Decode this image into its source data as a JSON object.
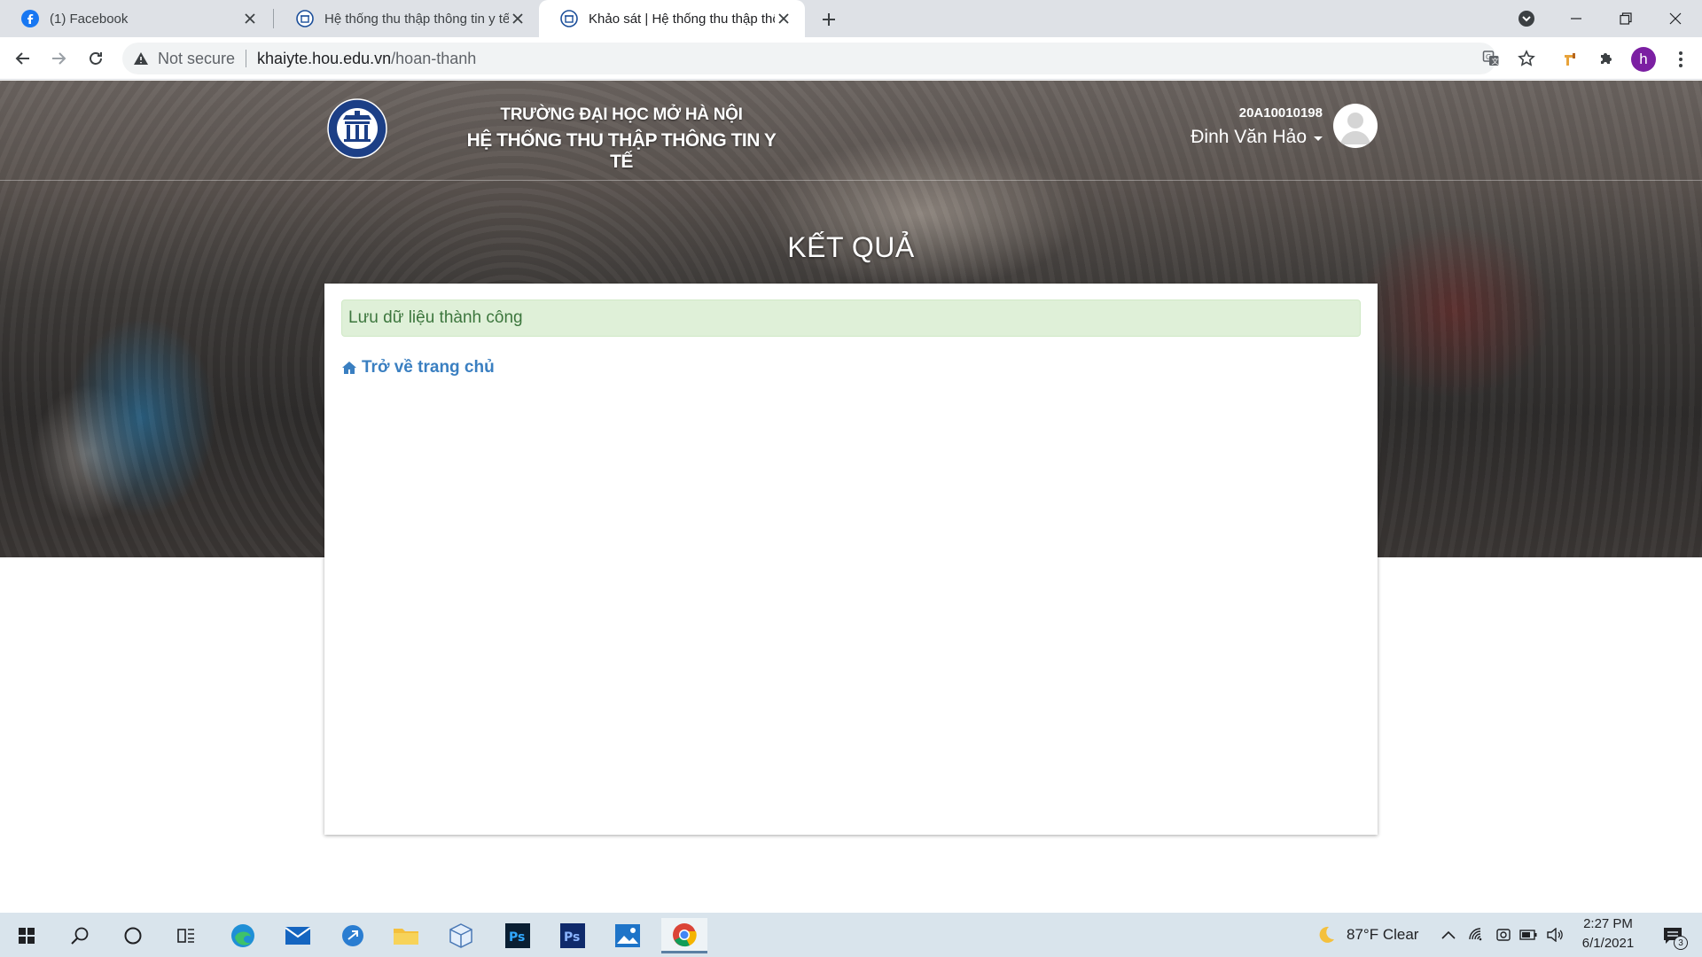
{
  "browser": {
    "tabs": [
      {
        "title": "(1) Facebook",
        "icon": "facebook-icon"
      },
      {
        "title": "Hệ thống thu thập thông tin y tế",
        "icon": "hou-icon"
      },
      {
        "title": "Khảo sát | Hệ thống thu thập thô",
        "icon": "hou-icon"
      }
    ],
    "address": {
      "security_label": "Not secure",
      "host": "khaiyte.hou.edu.vn",
      "path": "/hoan-thanh"
    },
    "profile_initial": "h"
  },
  "header": {
    "university": "TRƯỜNG ĐẠI HỌC MỞ HÀ NỘI",
    "system": "HỆ THỐNG THU THẬP THÔNG TIN Y TẾ",
    "student_id": "20A10010198",
    "user_name": "Đinh Văn Hảo"
  },
  "main": {
    "title": "KẾT QUẢ",
    "alert": "Lưu dữ liệu thành công",
    "home_link": "Trở về trang chủ"
  },
  "taskbar": {
    "weather": "87°F  Clear",
    "time": "2:27 PM",
    "date": "6/1/2021",
    "notification_count": "3"
  },
  "colors": {
    "accent_link": "#3a7fc1",
    "alert_bg": "#dff0d8",
    "alert_text": "#3c763d",
    "profile": "#7b1fa2"
  }
}
